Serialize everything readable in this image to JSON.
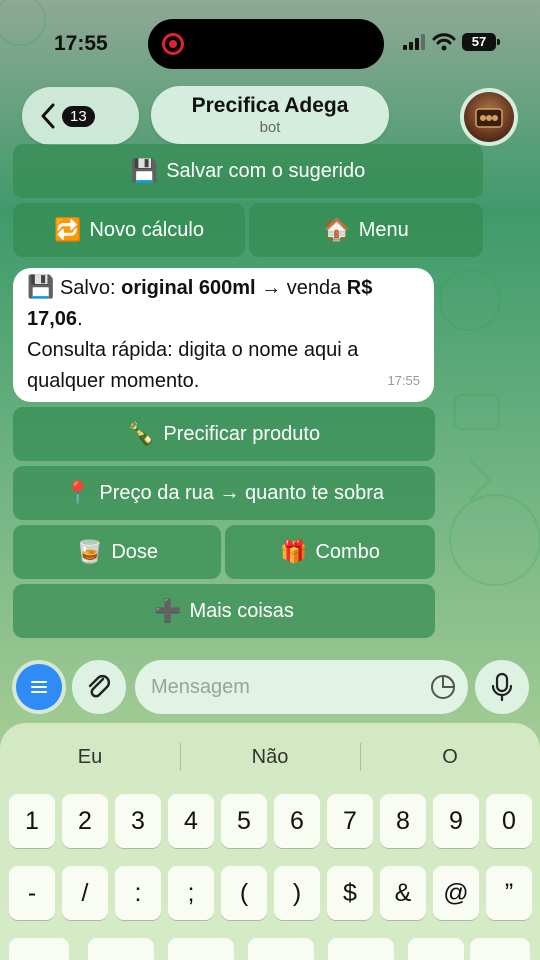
{
  "status_bar": {
    "time": "17:55",
    "battery": "57"
  },
  "header": {
    "back_count": "13",
    "title": "Precifica Adega",
    "subtitle": "bot"
  },
  "top_buttons": {
    "save_suggested": "Salvar com o sugerido",
    "new_calc": "Novo cálculo",
    "menu": "Menu"
  },
  "message": {
    "line1_prefix": "Salvo: ",
    "line1_bold": "original 600ml",
    "line1_mid": " → venda ",
    "line1_bold2": "R$ 17,06",
    "line1_end": ".",
    "line2": "Consulta rápida: digita o nome aqui a qualquer momento.",
    "time": "17:55"
  },
  "bot_buttons": {
    "price_product": "Precificar produto",
    "street_price": "Preço da rua → quanto te sobra",
    "dose": "Dose",
    "combo": "Combo",
    "more": "Mais coisas"
  },
  "input": {
    "placeholder": "Mensagem"
  },
  "keyboard": {
    "suggestions": [
      "Eu",
      "Não",
      "O"
    ],
    "row1": [
      "1",
      "2",
      "3",
      "4",
      "5",
      "6",
      "7",
      "8",
      "9",
      "0"
    ],
    "row2": [
      "-",
      "/",
      ":",
      ";",
      "(",
      ")",
      "$",
      "&",
      "@",
      "”"
    ]
  },
  "icons": {
    "floppy": "floppy-disk-icon",
    "repeat": "repeat-icon",
    "house": "house-icon",
    "bottle": "bottle-icon",
    "pin": "pin-icon",
    "glass": "whisky-glass-icon",
    "gift": "gift-icon",
    "plus": "plus-icon"
  },
  "colors": {
    "bubble": "#ffffff",
    "bot_button": "#348c52",
    "menu_button": "#2f8cf6"
  }
}
